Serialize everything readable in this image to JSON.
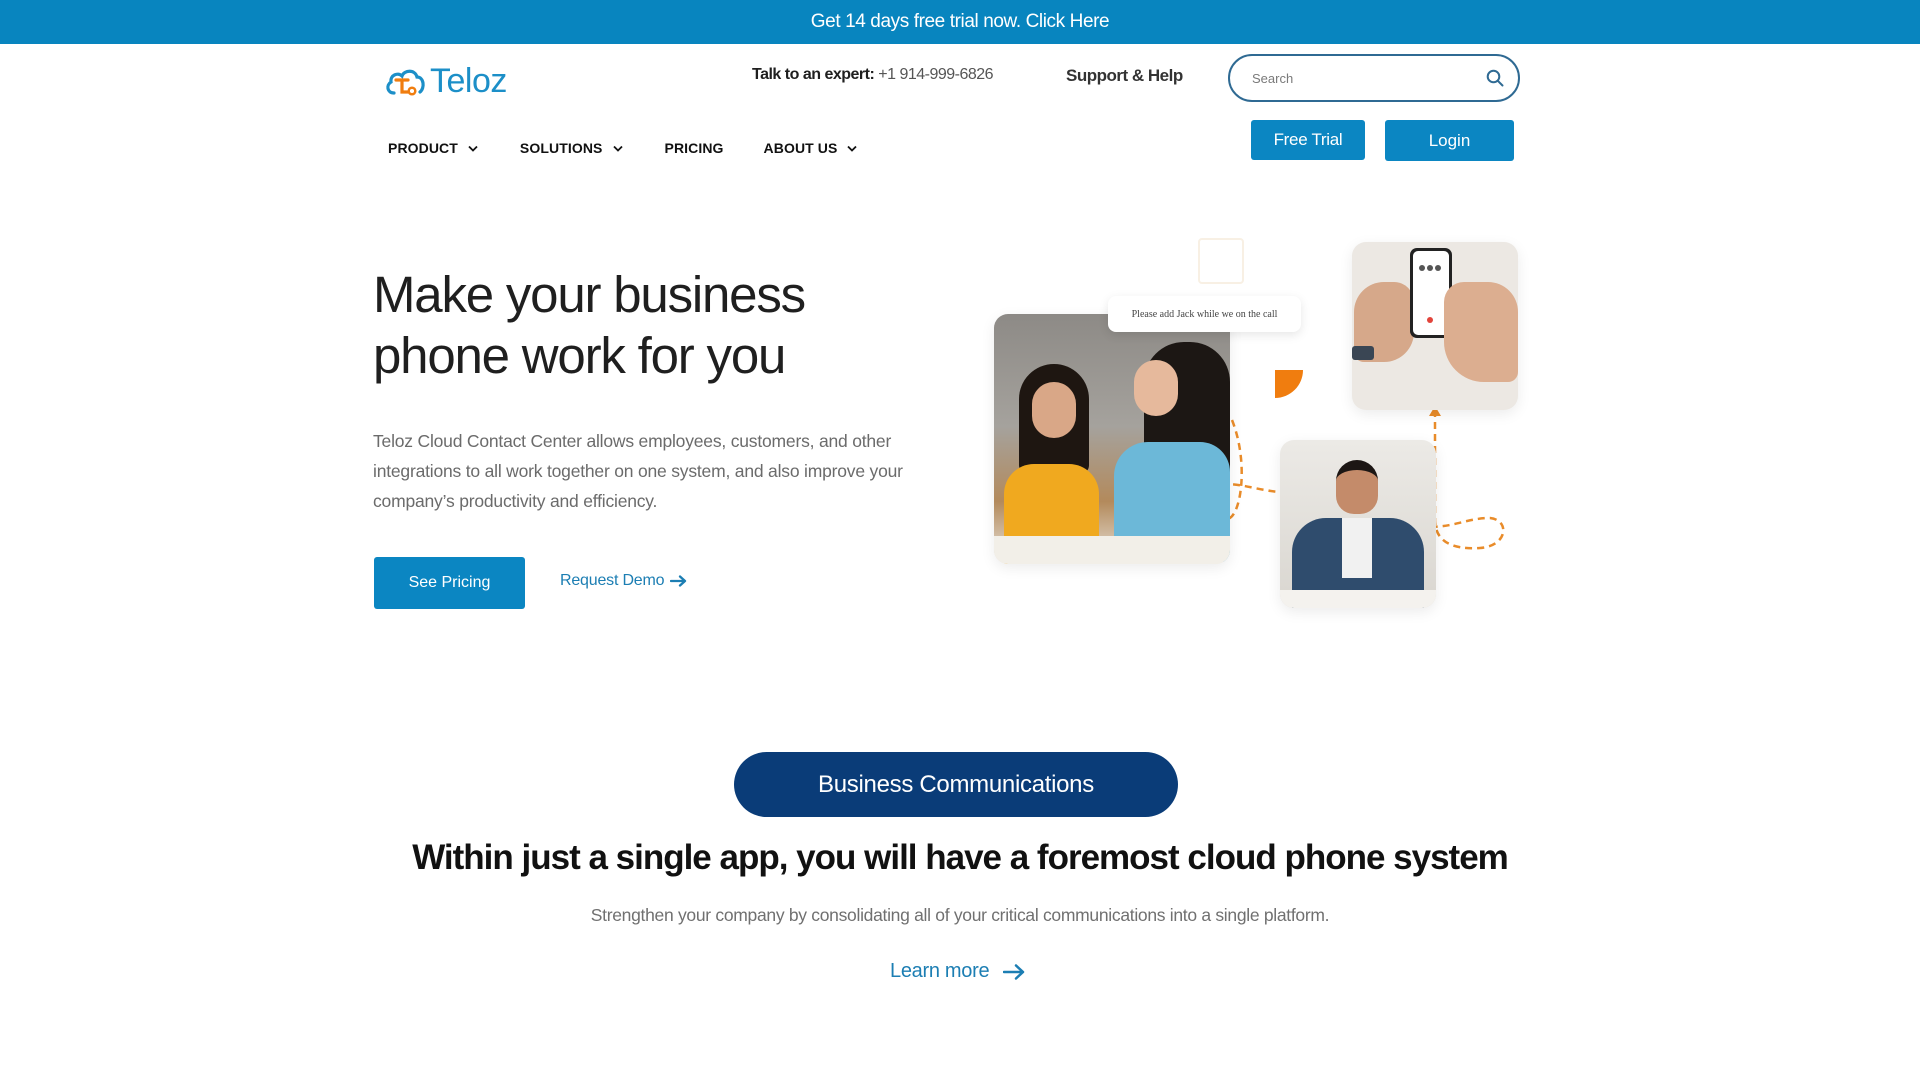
{
  "promo": {
    "text": "Get 14 days free trial now. Click Here"
  },
  "brand": {
    "name": "Teloz",
    "primary_color": "#0b86c2",
    "accent_color": "#f07d0f",
    "dark_color": "#0a3c78"
  },
  "header": {
    "expert_label": "Talk to an expert:",
    "expert_phone": "+1 914-999-6826",
    "support_label": "Support & Help",
    "search_placeholder": "Search",
    "search_value": "",
    "free_trial_label": "Free Trial",
    "login_label": "Login"
  },
  "nav": {
    "items": [
      {
        "label": "PRODUCT",
        "has_dropdown": true
      },
      {
        "label": "SOLUTIONS",
        "has_dropdown": true
      },
      {
        "label": "PRICING",
        "has_dropdown": false
      },
      {
        "label": "ABOUT US",
        "has_dropdown": true
      }
    ]
  },
  "hero": {
    "title_line1": "Make your business",
    "title_line2": "phone work for you",
    "description": "Teloz Cloud Contact Center allows employees, customers, and other  integrations to all work together on one system, and also improve your company’s productivity and efficiency.",
    "primary_cta": "See Pricing",
    "secondary_cta": "Request Demo",
    "chat_bubble": "Please add Jack while we on the call",
    "images": [
      {
        "name": "two-women-meeting-photo"
      },
      {
        "name": "hands-holding-phone-call-photo"
      },
      {
        "name": "smiling-man-at-desk-photo"
      }
    ]
  },
  "section": {
    "badge": "Business Communications",
    "title": "Within just a single app, you will have a foremost cloud phone system",
    "subtitle": "Strengthen your company by consolidating all of your critical communications into a single platform.",
    "link": "Learn more"
  }
}
